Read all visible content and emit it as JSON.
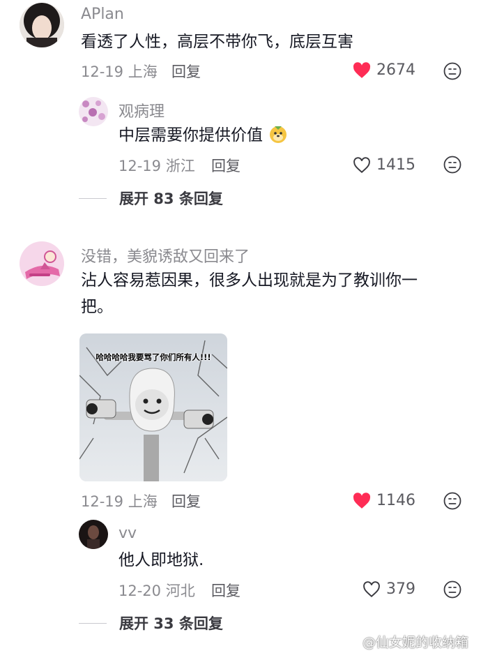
{
  "comments": [
    {
      "username": "APlan",
      "text": "看透了人性，高层不带你飞，底层互害",
      "date": "12-19",
      "location": "上海",
      "reply_label": "回复",
      "likes": "2674",
      "liked": true,
      "replies": [
        {
          "username": "观病理",
          "text": "中层需要你提供价值",
          "date": "12-19",
          "location": "浙江",
          "reply_label": "回复",
          "likes": "1415",
          "liked": false
        }
      ],
      "expand_label": "展开 83 条回复"
    },
    {
      "username": "没错，美貌诱敌又回来了",
      "text_line1": "沾人容易惹因果，很多人出现就是为了教训你一",
      "text_line2": "把。",
      "image_caption": "哈哈哈哈我要骂了你们所有人!!!",
      "date": "12-19",
      "location": "上海",
      "reply_label": "回复",
      "likes": "1146",
      "liked": true,
      "replies": [
        {
          "username": "vv",
          "text": "他人即地狱.",
          "date": "12-20",
          "location": "河北",
          "reply_label": "回复",
          "likes": "379",
          "liked": false
        }
      ],
      "expand_label": "展开 33 条回复"
    }
  ],
  "watermark": "@仙女妮的收纳箱",
  "colors": {
    "like_red": "#fe2c55",
    "meta_gray": "#8a8a8f",
    "text": "#161823"
  }
}
